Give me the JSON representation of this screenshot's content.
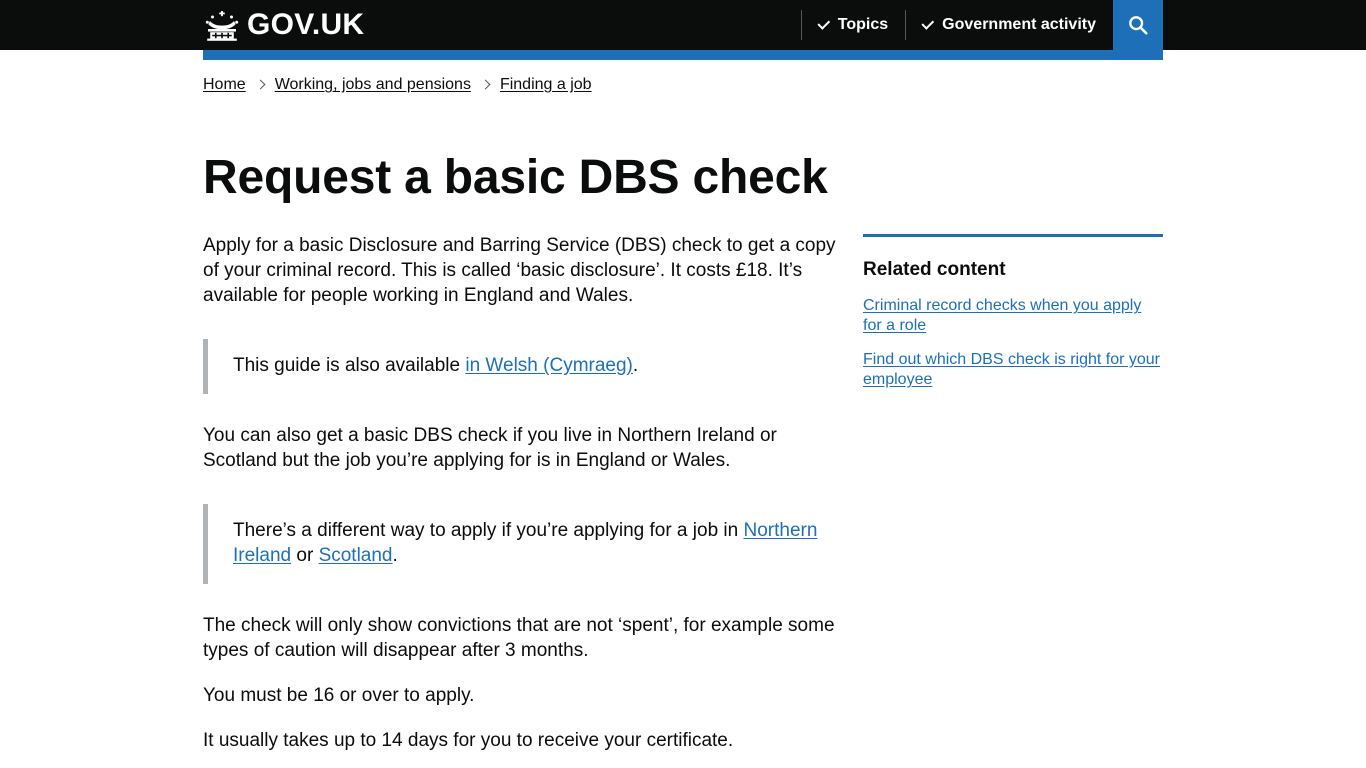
{
  "header": {
    "logo_text": "GOV.UK",
    "crown_icon": "crown-icon",
    "nav": [
      {
        "label": "Topics",
        "icon": "chevron-down-icon"
      },
      {
        "label": "Government activity",
        "icon": "chevron-down-icon"
      }
    ],
    "search_icon": "search-icon",
    "accent_color": "#1d70b8",
    "background_color": "#0b0c0c"
  },
  "breadcrumbs": [
    {
      "label": "Home"
    },
    {
      "label": "Working, jobs and pensions"
    },
    {
      "label": "Finding a job"
    }
  ],
  "main": {
    "title": "Request a basic DBS check",
    "paragraph_1": "Apply for a basic Disclosure and Barring Service (DBS) check to get a copy of your criminal record. This is called ‘basic disclosure’. It costs £18. It’s available for people working in England and Wales.",
    "inset_1": {
      "text_before": "This guide is also available ",
      "link": "in Welsh (Cymraeg)",
      "text_after": "."
    },
    "paragraph_2": "You can also get a basic DBS check if you live in Northern Ireland or Scotland but the job you’re applying for is in England or Wales.",
    "inset_2": {
      "text_before": "There’s a different way to apply if you’re applying for a job in ",
      "link_1": "Northern Ireland",
      "text_middle": " or ",
      "link_2": "Scotland",
      "text_after": "."
    },
    "paragraph_3": "The check will only show convictions that are not ‘spent’, for example some types of caution will disappear after 3 months.",
    "paragraph_4": "You must be 16 or over to apply.",
    "paragraph_5": "It usually takes up to 14 days for you to receive your certificate."
  },
  "sidebar": {
    "heading": "Related content",
    "links": [
      {
        "label": "Criminal record checks when you apply for a role"
      },
      {
        "label": "Find out which DBS check is right for your employee"
      }
    ]
  }
}
